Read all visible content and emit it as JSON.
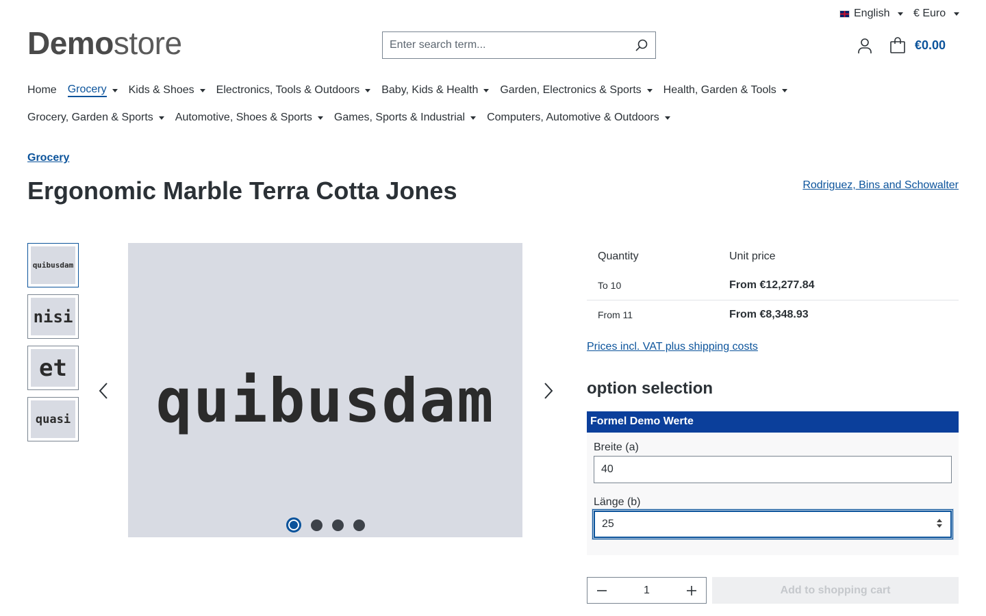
{
  "topbar": {
    "language": "English",
    "currency": "€ Euro"
  },
  "header": {
    "logo_bold": "Demo",
    "logo_light": "store",
    "search_placeholder": "Enter search term...",
    "cart_total": "€0.00"
  },
  "nav": {
    "row1": [
      {
        "label": "Home",
        "dropdown": false,
        "active": false
      },
      {
        "label": "Grocery",
        "dropdown": true,
        "active": true
      },
      {
        "label": "Kids & Shoes",
        "dropdown": true,
        "active": false
      },
      {
        "label": "Electronics, Tools & Outdoors",
        "dropdown": true,
        "active": false
      },
      {
        "label": "Baby, Kids & Health",
        "dropdown": true,
        "active": false
      },
      {
        "label": "Garden, Electronics & Sports",
        "dropdown": true,
        "active": false
      },
      {
        "label": "Health, Garden & Tools",
        "dropdown": true,
        "active": false
      }
    ],
    "row2": [
      {
        "label": "Grocery, Garden & Sports",
        "dropdown": true,
        "active": false
      },
      {
        "label": "Automotive, Shoes & Sports",
        "dropdown": true,
        "active": false
      },
      {
        "label": "Games, Sports & Industrial",
        "dropdown": true,
        "active": false
      },
      {
        "label": "Computers, Automotive & Outdoors",
        "dropdown": true,
        "active": false
      }
    ]
  },
  "product": {
    "breadcrumb": "Grocery",
    "title": "Ergonomic Marble Terra Cotta Jones",
    "manufacturer": "Rodriguez, Bins and Schowalter",
    "main_image_text": "quibusdam",
    "thumbnails": [
      "quibusdam",
      "nisi",
      "et",
      "quasi"
    ],
    "slides": 4,
    "active_slide": 0
  },
  "prices": {
    "header_quantity": "Quantity",
    "header_unit_price": "Unit price",
    "rows": [
      {
        "qty": "To 10",
        "price": "From €12,277.84"
      },
      {
        "qty": "From 11",
        "price": "From €8,348.93"
      }
    ],
    "vat_link": "Prices incl. VAT plus shipping costs"
  },
  "options": {
    "title": "option selection",
    "group_title": "Formel Demo Werte",
    "width_label": "Breite (a)",
    "width_value": "40",
    "length_label": "Länge (b)",
    "length_value": "25"
  },
  "buy": {
    "quantity": "1",
    "add_to_cart": "Add to shopping cart"
  },
  "colors": {
    "accent": "#0b539b",
    "formel_header": "#0b3f9b"
  }
}
